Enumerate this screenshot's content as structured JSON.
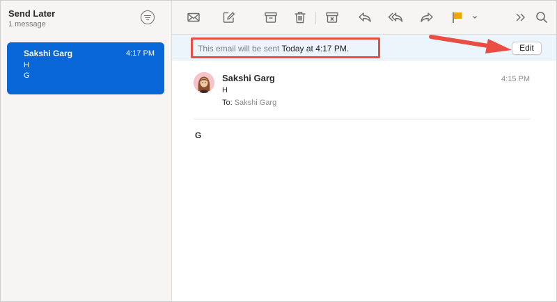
{
  "mailbox": {
    "title": "Send Later",
    "subtitle": "1 message"
  },
  "message_list": [
    {
      "sender": "Sakshi Garg",
      "time": "4:17 PM",
      "subject": "H",
      "preview": "G"
    }
  ],
  "toolbar": {
    "icons": [
      "filter-icon",
      "envelope-icon",
      "compose-icon",
      "archive-icon",
      "trash-icon",
      "junk-icon",
      "reply-icon",
      "reply-all-icon",
      "forward-icon",
      "flag-icon",
      "chevron-down-icon",
      "more-icon",
      "search-icon"
    ],
    "flag_color": "#f2a20c"
  },
  "banner": {
    "prefix": "This email will be sent",
    "when": "Today at 4:17 PM.",
    "edit_label": "Edit"
  },
  "message": {
    "from": "Sakshi Garg",
    "date": "4:15 PM",
    "subject": "H",
    "to_label": "To:",
    "to": "Sakshi Garg",
    "body": "G"
  },
  "colors": {
    "selection": "#0966d7",
    "annotation": "#ea4d42",
    "banner_bg": "#edf5fc"
  }
}
